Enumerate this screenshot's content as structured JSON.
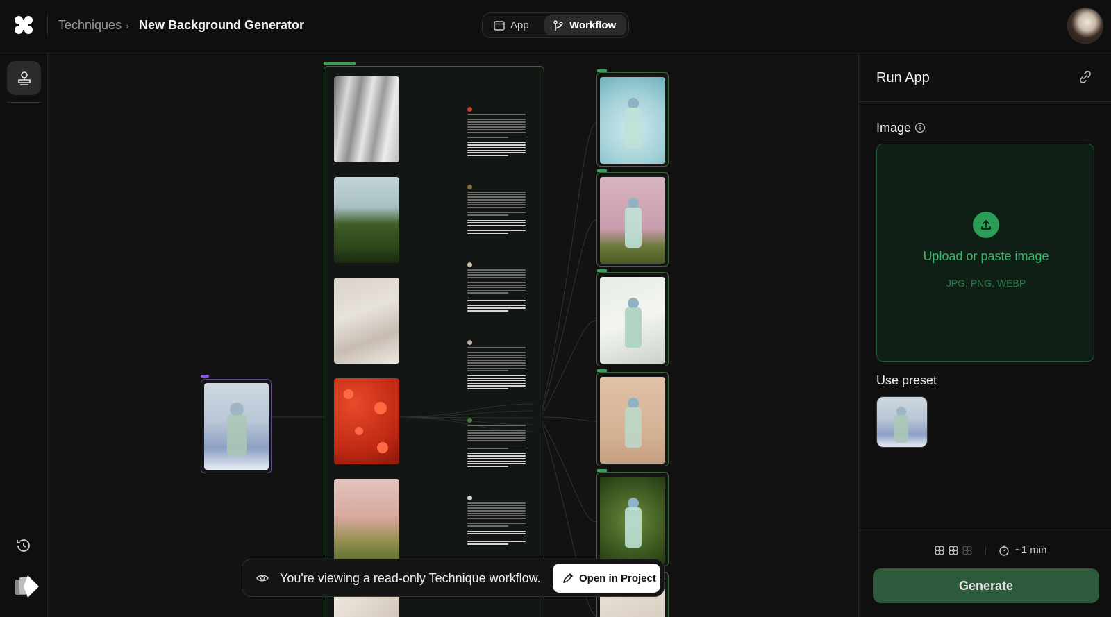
{
  "header": {
    "breadcrumb": [
      "Techniques",
      "New Background Generator"
    ],
    "chevron": "›",
    "toggle": {
      "app_label": "App",
      "workflow_label": "Workflow",
      "active": "Workflow"
    }
  },
  "banner": {
    "text": "You're viewing a read-only Technique workflow.",
    "button_label": "Open in Project"
  },
  "panel": {
    "title": "Run App",
    "image_label": "Image",
    "upload_text": "Upload or paste image",
    "upload_formats": "JPG, PNG, WEBP",
    "preset_label": "Use preset",
    "time_estimate": "~1 min",
    "generate_label": "Generate"
  },
  "colors": {
    "accent_green": "#2a9d57",
    "generate_bg": "#2e5a3c",
    "node_green": "#2f6b3e",
    "node_purple": "#5c4a8a"
  }
}
